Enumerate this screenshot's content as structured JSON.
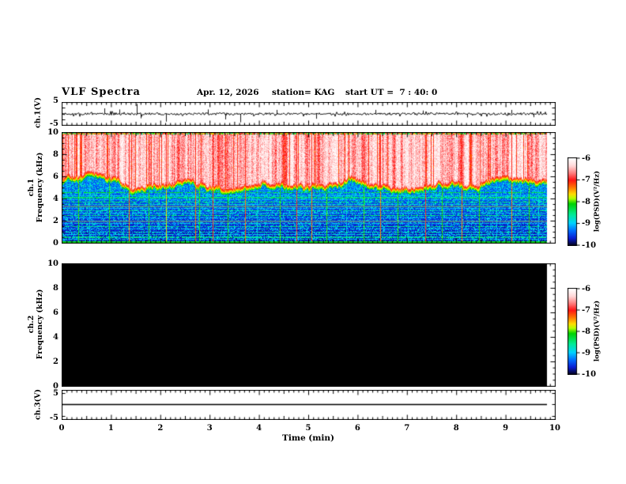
{
  "title": "VLF Spectra",
  "header": {
    "date": "Apr. 12, 2026",
    "station": "station= KAG",
    "start_ut": "start UT =  7 : 40: 0"
  },
  "xaxis": {
    "label": "Time (min)",
    "tick_labels": [
      "0",
      "1",
      "2",
      "3",
      "4",
      "5",
      "6",
      "7",
      "8",
      "9",
      "10"
    ],
    "range_min": [
      0,
      10
    ],
    "data_end_min": 9.8
  },
  "panels": {
    "ch1_wave": {
      "ylabel": "ch.1(V)",
      "ytick_labels": [
        "5",
        "-5"
      ],
      "ylim_v": [
        -5,
        5
      ]
    },
    "ch1_spec": {
      "ylabel_line1": "ch.1",
      "ylabel_line2": "Frequency (kHz)",
      "ytick_labels": [
        "10",
        "8",
        "6",
        "4",
        "2",
        "0"
      ],
      "ylim_khz": [
        0,
        10
      ]
    },
    "ch2_spec": {
      "ylabel_line1": "ch.2",
      "ylabel_line2": "Frequency (kHz)",
      "ytick_labels": [
        "10",
        "8",
        "6",
        "4",
        "2",
        "0"
      ],
      "ylim_khz": [
        0,
        10
      ]
    },
    "ch3_wave": {
      "ylabel": "ch.3(V)",
      "ytick_labels": [
        "5",
        "-5"
      ],
      "ylim_v": [
        -5,
        5
      ]
    }
  },
  "colorbars": {
    "label": "log(PSD)(V²/Hz)",
    "tick_labels": [
      "-6",
      "-7",
      "-8",
      "-9",
      "-10"
    ],
    "range_log_psd": [
      -6,
      -10
    ]
  },
  "chart_data": [
    {
      "id": "ch1_wave",
      "type": "line",
      "title": "ch.1 voltage waveform",
      "x_range_min": [
        0,
        9.8
      ],
      "ylim_v": [
        -5,
        5
      ],
      "baseline_v": 0,
      "noise_amplitude_v": 0.45,
      "spikes": [
        {
          "t_min": 0.85,
          "amp_v": 2.5
        },
        {
          "t_min": 1.15,
          "amp_v": 2.0
        },
        {
          "t_min": 1.5,
          "amp_v": 4.5
        },
        {
          "t_min": 1.58,
          "amp_v": -2.0
        },
        {
          "t_min": 2.1,
          "amp_v": -3.5
        },
        {
          "t_min": 2.95,
          "amp_v": 2.0
        },
        {
          "t_min": 3.3,
          "amp_v": -2.5
        },
        {
          "t_min": 3.6,
          "amp_v": -3.8
        },
        {
          "t_min": 4.35,
          "amp_v": 1.8
        },
        {
          "t_min": 5.15,
          "amp_v": -2.2
        },
        {
          "t_min": 6.35,
          "amp_v": 1.8
        },
        {
          "t_min": 7.3,
          "amp_v": 1.5
        },
        {
          "t_min": 8.2,
          "amp_v": -1.6
        },
        {
          "t_min": 9.1,
          "amp_v": 1.8
        },
        {
          "t_min": 9.55,
          "amp_v": -1.5
        }
      ]
    },
    {
      "id": "ch1_spec",
      "type": "heatmap",
      "title": "ch.1 VLF spectrogram",
      "x_range_min": [
        0,
        9.8
      ],
      "f_range_khz": [
        0,
        10
      ],
      "z_range_log_psd": [
        -10,
        -6
      ],
      "broadband_emission": {
        "f_bottom_khz": [
          4.6,
          5.8
        ],
        "f_top_khz": 10,
        "level_log_psd": [
          -7.1,
          -6.0
        ]
      },
      "background_level_log_psd": -9.8,
      "bottom_edge_line": {
        "f_khz": 0,
        "level_log_psd": -8.2
      },
      "horizontal_lines": [
        {
          "f_khz": 4.55,
          "level": -8.3
        },
        {
          "f_khz": 4.3,
          "level": -8.9
        },
        {
          "f_khz": 4.1,
          "level": -8.5
        },
        {
          "f_khz": 3.9,
          "level": -9.0
        },
        {
          "f_khz": 3.7,
          "level": -8.5
        },
        {
          "f_khz": 3.5,
          "level": -8.8
        },
        {
          "f_khz": 3.3,
          "level": -8.5
        },
        {
          "f_khz": 3.1,
          "level": -9.0
        },
        {
          "f_khz": 2.9,
          "level": -8.6
        },
        {
          "f_khz": 2.7,
          "level": -8.9
        },
        {
          "f_khz": 2.5,
          "level": -8.5
        },
        {
          "f_khz": 2.25,
          "level": -9.0
        },
        {
          "f_khz": 2.0,
          "level": -8.7
        },
        {
          "f_khz": 1.75,
          "level": -8.9
        },
        {
          "f_khz": 1.5,
          "level": -8.6
        },
        {
          "f_khz": 1.25,
          "level": -9.0
        },
        {
          "f_khz": 1.0,
          "level": -8.7
        },
        {
          "f_khz": 0.75,
          "level": -8.9
        },
        {
          "f_khz": 0.5,
          "level": -8.6
        },
        {
          "f_khz": 0.3,
          "level": -9.0
        }
      ],
      "gray_bands_khz": [
        3.4,
        2.0
      ],
      "vertical_streaks": [
        {
          "t_min": 0.32,
          "color": "green"
        },
        {
          "t_min": 0.55,
          "color": "cyan"
        },
        {
          "t_min": 0.95,
          "color": "green"
        },
        {
          "t_min": 1.35,
          "color": "orange"
        },
        {
          "t_min": 1.75,
          "color": "green"
        },
        {
          "t_min": 2.1,
          "color": "yellow"
        },
        {
          "t_min": 2.7,
          "color": "orange"
        },
        {
          "t_min": 2.78,
          "color": "green"
        },
        {
          "t_min": 3.05,
          "color": "red"
        },
        {
          "t_min": 3.35,
          "color": "green"
        },
        {
          "t_min": 3.7,
          "color": "orange"
        },
        {
          "t_min": 3.95,
          "color": "cyan"
        },
        {
          "t_min": 4.4,
          "color": "green"
        },
        {
          "t_min": 4.75,
          "color": "red"
        },
        {
          "t_min": 5.05,
          "color": "orange"
        },
        {
          "t_min": 5.35,
          "color": "green"
        },
        {
          "t_min": 5.75,
          "color": "cyan"
        },
        {
          "t_min": 6.1,
          "color": "green"
        },
        {
          "t_min": 6.45,
          "color": "orange"
        },
        {
          "t_min": 6.8,
          "color": "green"
        },
        {
          "t_min": 7.0,
          "color": "cyan"
        },
        {
          "t_min": 7.35,
          "color": "red"
        },
        {
          "t_min": 7.7,
          "color": "green"
        },
        {
          "t_min": 8.1,
          "color": "orange"
        },
        {
          "t_min": 8.45,
          "color": "green"
        },
        {
          "t_min": 8.8,
          "color": "cyan"
        },
        {
          "t_min": 9.1,
          "color": "orange"
        },
        {
          "t_min": 9.45,
          "color": "green"
        },
        {
          "t_min": 9.65,
          "color": "cyan"
        }
      ],
      "streak_levels": {
        "red": -7.0,
        "orange": -7.3,
        "yellow": -7.7,
        "green": -8.1,
        "cyan": -9.0
      },
      "colormap_stops": [
        {
          "level": -6.0,
          "rgb": [
            255,
            255,
            255
          ]
        },
        {
          "level": -6.35,
          "rgb": [
            255,
            215,
            215
          ]
        },
        {
          "level": -6.7,
          "rgb": [
            255,
            120,
            120
          ]
        },
        {
          "level": -7.0,
          "rgb": [
            255,
            20,
            20
          ]
        },
        {
          "level": -7.35,
          "rgb": [
            255,
            120,
            0
          ]
        },
        {
          "level": -7.65,
          "rgb": [
            255,
            220,
            0
          ]
        },
        {
          "level": -7.85,
          "rgb": [
            180,
            255,
            0
          ]
        },
        {
          "level": -8.1,
          "rgb": [
            0,
            210,
            0
          ]
        },
        {
          "level": -8.6,
          "rgb": [
            0,
            235,
            150
          ]
        },
        {
          "level": -9.0,
          "rgb": [
            0,
            210,
            255
          ]
        },
        {
          "level": -9.35,
          "rgb": [
            0,
            110,
            255
          ]
        },
        {
          "level": -9.7,
          "rgb": [
            10,
            30,
            210
          ]
        },
        {
          "level": -10.0,
          "rgb": [
            5,
            5,
            45
          ]
        }
      ]
    },
    {
      "id": "ch2_spec",
      "type": "heatmap",
      "title": "ch.2 VLF spectrogram",
      "x_range_min": [
        0,
        9.8
      ],
      "f_range_khz": [
        0,
        10
      ],
      "z_range_log_psd": [
        -10,
        -6
      ],
      "content": "no signal - uniform black (at or below -10)"
    },
    {
      "id": "ch3_wave",
      "type": "line",
      "title": "ch.3 voltage waveform",
      "x_range_min": [
        0,
        9.8
      ],
      "ylim_v": [
        -5,
        5
      ],
      "values": "constant 0 V flat line"
    }
  ]
}
